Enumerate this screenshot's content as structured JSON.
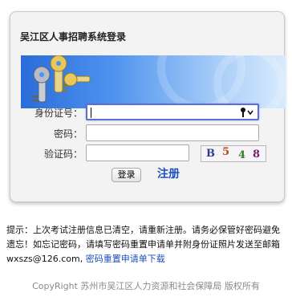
{
  "login": {
    "title": "吴江区人事招聘系统登录",
    "id_label": "身份证号：",
    "id_value": "",
    "password_label": "密码：",
    "password_value": "",
    "captcha_label": "验证码：",
    "captcha_value": "",
    "captcha_text": [
      "B",
      "5",
      "4",
      "8"
    ],
    "login_button": "登录",
    "register_link": "注册"
  },
  "notice": {
    "text": "提示：上次考试注册信息已清空，请重新注册。请务必保管好密码避免遗忘！如忘记密码，请填写密码重置申请单并附身份证照片发送至邮箱wxszs@126.com, ",
    "link": "密码重置申请单下载"
  },
  "footer": {
    "copyright": "CopyRight 苏州市吴江区人力资源和社会保障局 版权所有"
  },
  "colors": {
    "accent": "#1f4fbf",
    "banner_start": "#2a6cd9",
    "banner_end": "#d8ebfd",
    "focus_border": "#5b6fd6"
  },
  "icons": {
    "banner": "keys-icon",
    "id_field_ctl": "key-dropdown-icon"
  }
}
